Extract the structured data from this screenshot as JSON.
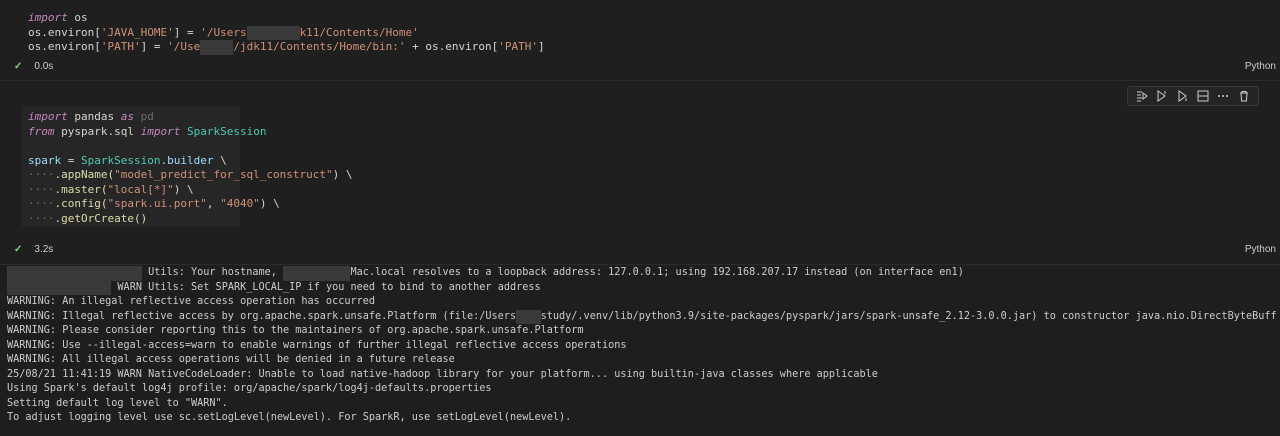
{
  "cell1": {
    "code": {
      "line1_kw": "import",
      "line1_mod": " os",
      "line2_a": "os.environ[",
      "line2_key": "'JAVA_HOME'",
      "line2_b": "] = ",
      "line2_val1": "'/Users",
      "line2_val2": "k11/Contents/Home'",
      "line3_a": "os.environ[",
      "line3_key": "'PATH'",
      "line3_b": "] = ",
      "line3_val1": "'/Use",
      "line3_val2": "/jdk11/Contents/Home/bin:'",
      "line3_c": " + os.environ[",
      "line3_key2": "'PATH'",
      "line3_d": "]"
    },
    "status_time": "0.0s",
    "language": "Python"
  },
  "cell2": {
    "code": {
      "l1_import": "import",
      "l1_mod": " pandas ",
      "l1_as": "as",
      "l1_alias": " pd",
      "l2_from": "from",
      "l2_mod": " pyspark.sql ",
      "l2_import": "import",
      "l2_cls": " SparkSession",
      "l4_var": "spark",
      "l4_eq": " = ",
      "l4_cls": "SparkSession",
      "l4_attr": ".builder",
      "l4_cont": " \\",
      "l5_fn": ".appName(",
      "l5_str": "\"model_predict_for_sql_construct\"",
      "l5_end": ") \\",
      "l6_fn": ".master(",
      "l6_str": "\"local[*]\"",
      "l6_end": ") \\",
      "l7_fn": ".config(",
      "l7_str1": "\"spark.ui.port\"",
      "l7_comma": ", ",
      "l7_str2": "\"4040\"",
      "l7_end": ") \\",
      "l8_fn": ".getOrCreate()",
      "indent": "····"
    },
    "status_time": "3.2s",
    "language": "Python"
  },
  "toolbar": {
    "items": [
      "run-by-line-icon",
      "execute-above-icon",
      "execute-below-icon",
      "split-cell-icon",
      "more-icon",
      "delete-icon"
    ]
  },
  "output": {
    "lines": [
      "Utils: Your hostname, ",
      "Mac.local resolves to a loopback address: 127.0.0.1; using 192.168.207.17 instead (on interface en1)",
      "WARN Utils: Set SPARK_LOCAL_IP if you need to bind to another address",
      "WARNING: An illegal reflective access operation has occurred",
      "WARNING: Illegal reflective access by org.apache.spark.unsafe.Platform (file:/Users",
      "study/.venv/lib/python3.9/site-packages/pyspark/jars/spark-unsafe_2.12-3.0.0.jar) to constructor java.nio.DirectByteBuffer(long,int)",
      "WARNING: Please consider reporting this to the maintainers of org.apache.spark.unsafe.Platform",
      "WARNING: Use --illegal-access=warn to enable warnings of further illegal reflective access operations",
      "WARNING: All illegal access operations will be denied in a future release",
      "25/08/21 11:41:19 WARN NativeCodeLoader: Unable to load native-hadoop library for your platform... using builtin-java classes where applicable",
      "Using Spark's default log4j profile: org/apache/spark/log4j-defaults.properties",
      "Setting default log level to \"WARN\".",
      "To adjust logging level use sc.setLogLevel(newLevel). For SparkR, use setLogLevel(newLevel).",
      "25/08/21",
      "25/08/21"
    ]
  }
}
